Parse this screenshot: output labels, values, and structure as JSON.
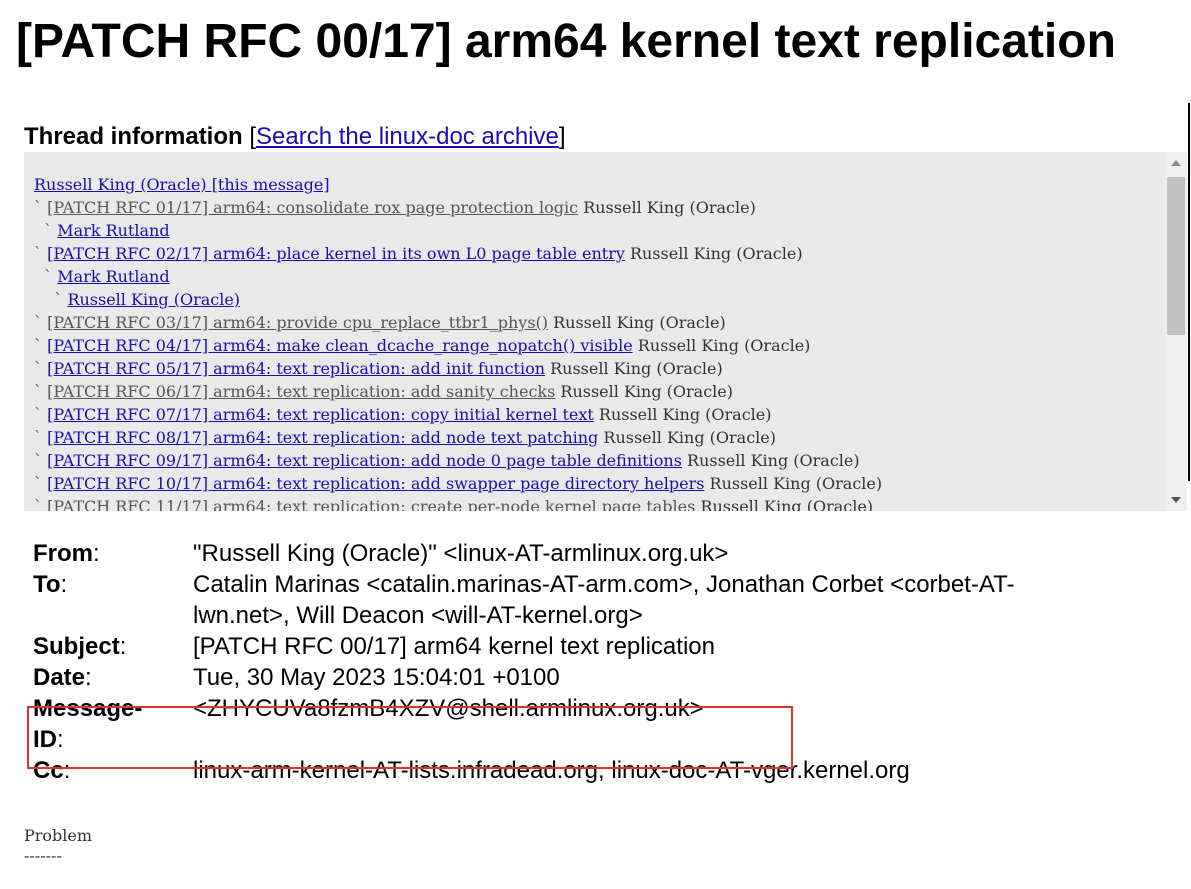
{
  "page": {
    "title": "[PATCH RFC 00/17] arm64 kernel text replication"
  },
  "thread": {
    "heading": "Thread information",
    "bracket_open": "[",
    "search_link": "Search the linux-doc archive",
    "bracket_close": "]",
    "root": "Russell King (Oracle) [this message]",
    "entries": [
      {
        "prefix": "` ",
        "link": "[PATCH RFC 01/17] arm64: consolidate rox page protection logic",
        "author": "Russell King (Oracle)",
        "visited": true
      },
      {
        "prefix": "  ` ",
        "link": "Mark Rutland",
        "author": "",
        "visited": false
      },
      {
        "prefix": "` ",
        "link": "[PATCH RFC 02/17] arm64: place kernel in its own L0 page table entry",
        "author": "Russell King (Oracle)",
        "visited": false
      },
      {
        "prefix": "  ` ",
        "link": "Mark Rutland",
        "author": "",
        "visited": false
      },
      {
        "prefix": "    ` ",
        "link": "Russell King (Oracle)",
        "author": "",
        "visited": false
      },
      {
        "prefix": "` ",
        "link": "[PATCH RFC 03/17] arm64: provide cpu_replace_ttbr1_phys()",
        "author": "Russell King (Oracle)",
        "visited": true
      },
      {
        "prefix": "` ",
        "link": "[PATCH RFC 04/17] arm64: make clean_dcache_range_nopatch() visible",
        "author": "Russell King (Oracle)",
        "visited": false
      },
      {
        "prefix": "` ",
        "link": "[PATCH RFC 05/17] arm64: text replication: add init function",
        "author": "Russell King (Oracle)",
        "visited": false
      },
      {
        "prefix": "` ",
        "link": "[PATCH RFC 06/17] arm64: text replication: add sanity checks",
        "author": "Russell King (Oracle)",
        "visited": true
      },
      {
        "prefix": "` ",
        "link": "[PATCH RFC 07/17] arm64: text replication: copy initial kernel text",
        "author": "Russell King (Oracle)",
        "visited": false
      },
      {
        "prefix": "` ",
        "link": "[PATCH RFC 08/17] arm64: text replication: add node text patching",
        "author": "Russell King (Oracle)",
        "visited": false
      },
      {
        "prefix": "` ",
        "link": "[PATCH RFC 09/17] arm64: text replication: add node 0 page table definitions",
        "author": "Russell King (Oracle)",
        "visited": false
      },
      {
        "prefix": "` ",
        "link": "[PATCH RFC 10/17] arm64: text replication: add swapper page directory helpers",
        "author": "Russell King (Oracle)",
        "visited": false
      },
      {
        "prefix": "` ",
        "link": "[PATCH RFC 11/17] arm64: text replication: create per-node kernel page tables",
        "author": "Russell King (Oracle)",
        "visited": true
      }
    ]
  },
  "headers": {
    "from_label": "From",
    "from_value": "\"Russell King (Oracle)\" <linux-AT-armlinux.org.uk>",
    "to_label": "To",
    "to_value": "Catalin Marinas <catalin.marinas-AT-arm.com>, Jonathan Corbet <corbet-AT-lwn.net>, Will Deacon <will-AT-kernel.org>",
    "subject_label": "Subject",
    "subject_value": "[PATCH RFC 00/17] arm64 kernel text replication",
    "date_label": "Date",
    "date_value": "Tue, 30 May 2023 15:04:01 +0100",
    "msgid_label": "Message-ID",
    "msgid_value": "<ZHYCUVa8fzmB4XZV@shell.armlinux.org.uk>",
    "cc_label": "Cc",
    "cc_value": "linux-arm-kernel-AT-lists.infradead.org, linux-doc-AT-vger.kernel.org",
    "colon": ":"
  },
  "body": {
    "text": "Problem\n-------"
  },
  "colors": {
    "link": "#1a0dab",
    "visited": "#555555",
    "highlight_border": "#e0322f",
    "thread_bg": "#e9e9e9"
  }
}
